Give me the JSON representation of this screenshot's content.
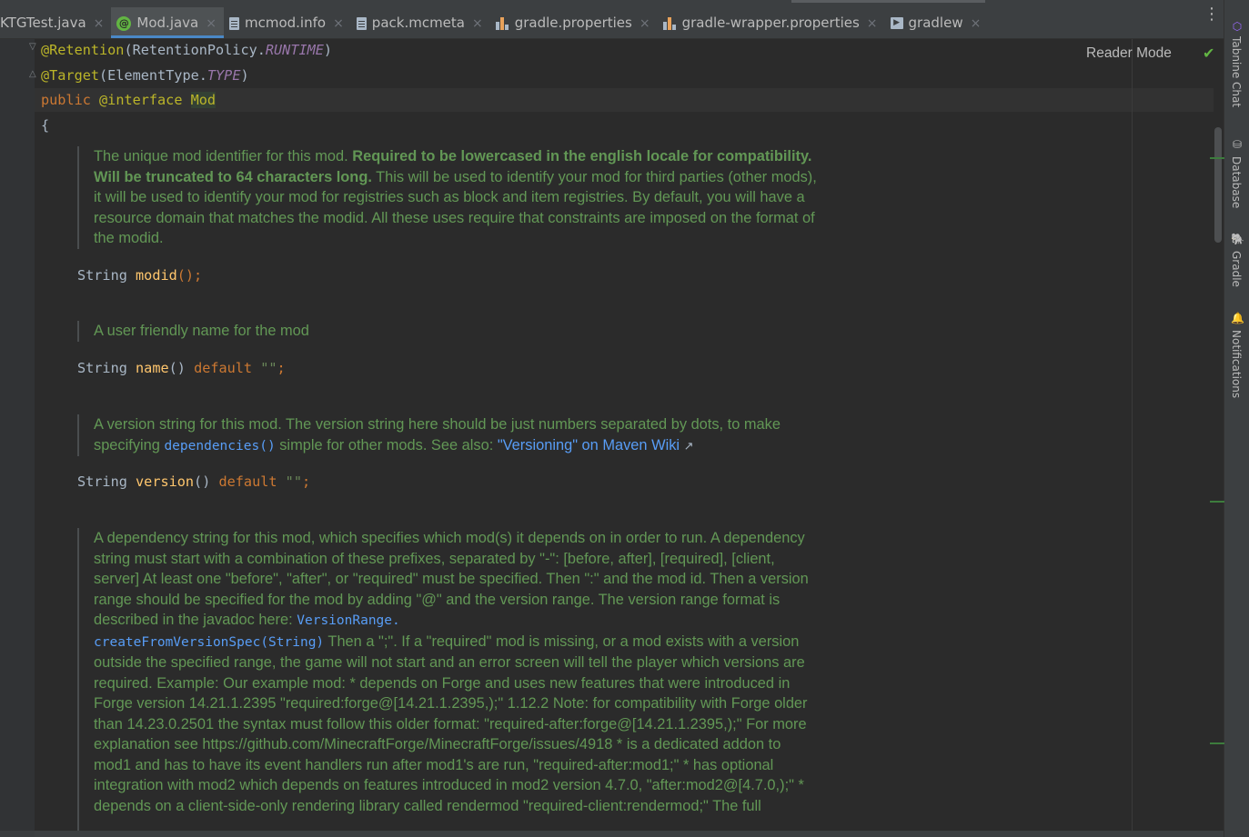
{
  "tabs": [
    {
      "label": "KTGTest.java",
      "icon": "java-file-icon",
      "active": false
    },
    {
      "label": "Mod.java",
      "icon": "annotation-icon",
      "active": true
    },
    {
      "label": "mcmod.info",
      "icon": "text-file-icon",
      "active": false
    },
    {
      "label": "pack.mcmeta",
      "icon": "text-file-icon",
      "active": false
    },
    {
      "label": "gradle.properties",
      "icon": "properties-file-icon",
      "active": false
    },
    {
      "label": "gradle-wrapper.properties",
      "icon": "properties-file-icon",
      "active": false
    },
    {
      "label": "gradlew",
      "icon": "shell-script-icon",
      "active": false
    }
  ],
  "tab_close_glyph": "×",
  "tab_menu_glyph": "⋮",
  "right_tools": [
    {
      "label": "Tabnine Chat",
      "icon": "tabnine-icon"
    },
    {
      "label": "Database",
      "icon": "database-icon"
    },
    {
      "label": "Gradle",
      "icon": "gradle-icon"
    },
    {
      "label": "Notifications",
      "icon": "bell-icon"
    }
  ],
  "editor": {
    "reader_mode": "Reader Mode",
    "code": {
      "line1": {
        "annot": "@Retention",
        "open": "(RetentionPolicy.",
        "const": "RUNTIME",
        "close": ")"
      },
      "line2": {
        "annot": "@Target",
        "open": "(ElementType.",
        "const": "TYPE",
        "close": ")"
      },
      "line3": {
        "kw": "public",
        "annot": "@interface",
        "name": "Mod"
      },
      "line4": "{",
      "modid": {
        "type": "String",
        "name": "modid",
        "rest": "();"
      },
      "name": {
        "type": "String",
        "name": "name",
        "parens": "()",
        "kw": "default",
        "str": "\"\"",
        "semi": ";"
      },
      "version": {
        "type": "String",
        "name": "version",
        "parens": "()",
        "kw": "default",
        "str": "\"\"",
        "semi": ";"
      }
    },
    "docs": {
      "modid": {
        "p1": "The unique mod identifier for this mod. ",
        "bold": "Required to be lowercased in the english locale for compatibility. Will be truncated to 64 characters long.",
        "p2": " This will be used to identify your mod for third parties (other mods), it will be used to identify your mod for registries such as block and item registries. By default, you will have a resource domain that matches the modid. All these uses require that constraints are imposed on the format of the modid."
      },
      "name": "A user friendly name for the mod",
      "version": {
        "p1": "A version string for this mod. The version string here should be just numbers separated by dots, to make specifying ",
        "code_link": "dependencies()",
        "p2": " simple for other mods. See also: ",
        "link": "\"Versioning\" on Maven Wiki",
        "ext": "↗"
      },
      "dependencies": {
        "p1": "A dependency string for this mod, which specifies which mod(s) it depends on in order to run. A dependency string must start with a combination of these prefixes, separated by \"-\": [before, after], [required], [client, server] At least one \"before\", \"after\", or \"required\" must be specified. Then \":\" and the mod id. Then a version range should be specified for the mod by adding \"@\" and the version range. The version range format is described in the javadoc here: ",
        "code_link1": "VersionRange.",
        "code_link2": "createFromVersionSpec(String)",
        "p2": " Then a \";\". If a \"required\" mod is missing, or a mod exists with a version outside the specified range, the game will not start and an error screen will tell the player which versions are required. Example: Our example mod: * depends on Forge and uses new features that were introduced in Forge version 14.21.1.2395 \"required:forge@[14.21.1.2395,);\" 1.12.2 Note: for compatibility with Forge older than 14.23.0.2501 the syntax must follow this older format: \"required-after:forge@[14.21.1.2395,);\" For more explanation see https://github.com/MinecraftForge/MinecraftForge/issues/4918 * is a dedicated addon to mod1 and has to have its event handlers run after mod1's are run, \"required-after:mod1;\" * has optional integration with mod2 which depends on features introduced in mod2 version 4.7.0, \"after:mod2@[4.7.0,);\" * depends on a client-side-only rendering library called rendermod \"required-client:rendermod;\" The full"
      }
    }
  },
  "colors": {
    "background": "#2b2b2b",
    "doc_text": "#629755",
    "link": "#589df6",
    "keyword": "#cc7832",
    "annotation": "#bbb529",
    "method": "#ffc66d"
  }
}
